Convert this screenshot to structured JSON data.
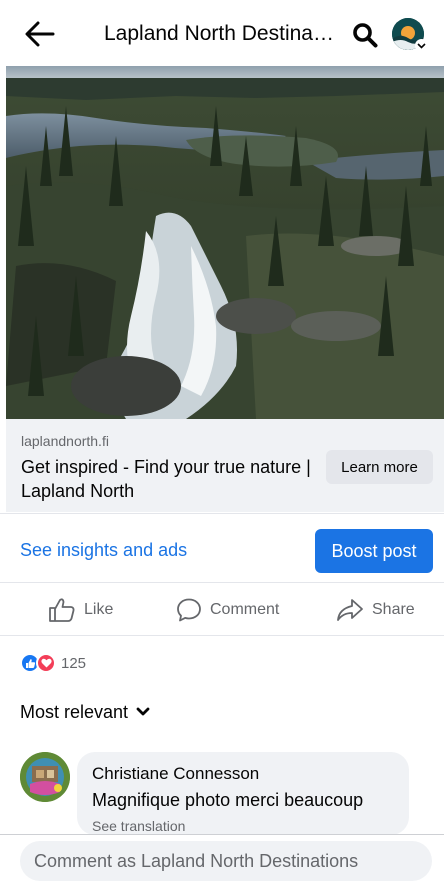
{
  "header": {
    "title": "Lapland North Destina…",
    "back_icon": "arrow-left-icon",
    "search_icon": "search-icon"
  },
  "post": {
    "image": "waterfall-river-landscape-photo",
    "link": {
      "domain": "laplandnorth.fi",
      "headline": "Get inspired - Find your true nature | Lapland North",
      "cta": "Learn more"
    },
    "insights_label": "See insights and ads",
    "boost_label": "Boost post",
    "actions": {
      "like": "Like",
      "comment": "Comment",
      "share": "Share"
    },
    "reactions": {
      "count": "125"
    }
  },
  "comments": {
    "sort_label": "Most relevant",
    "items": [
      {
        "author": "Christiane Connesson",
        "text": "Magnifique photo merci beaucoup",
        "translate": "See translation"
      }
    ],
    "composer_placeholder": "Comment as Lapland North Destinations"
  },
  "colors": {
    "accent": "#1b74e4",
    "secondary_text": "#65676b",
    "card_bg": "#f0f2f5",
    "like_reaction": "#1877f2",
    "love_reaction": "#f33e58"
  }
}
